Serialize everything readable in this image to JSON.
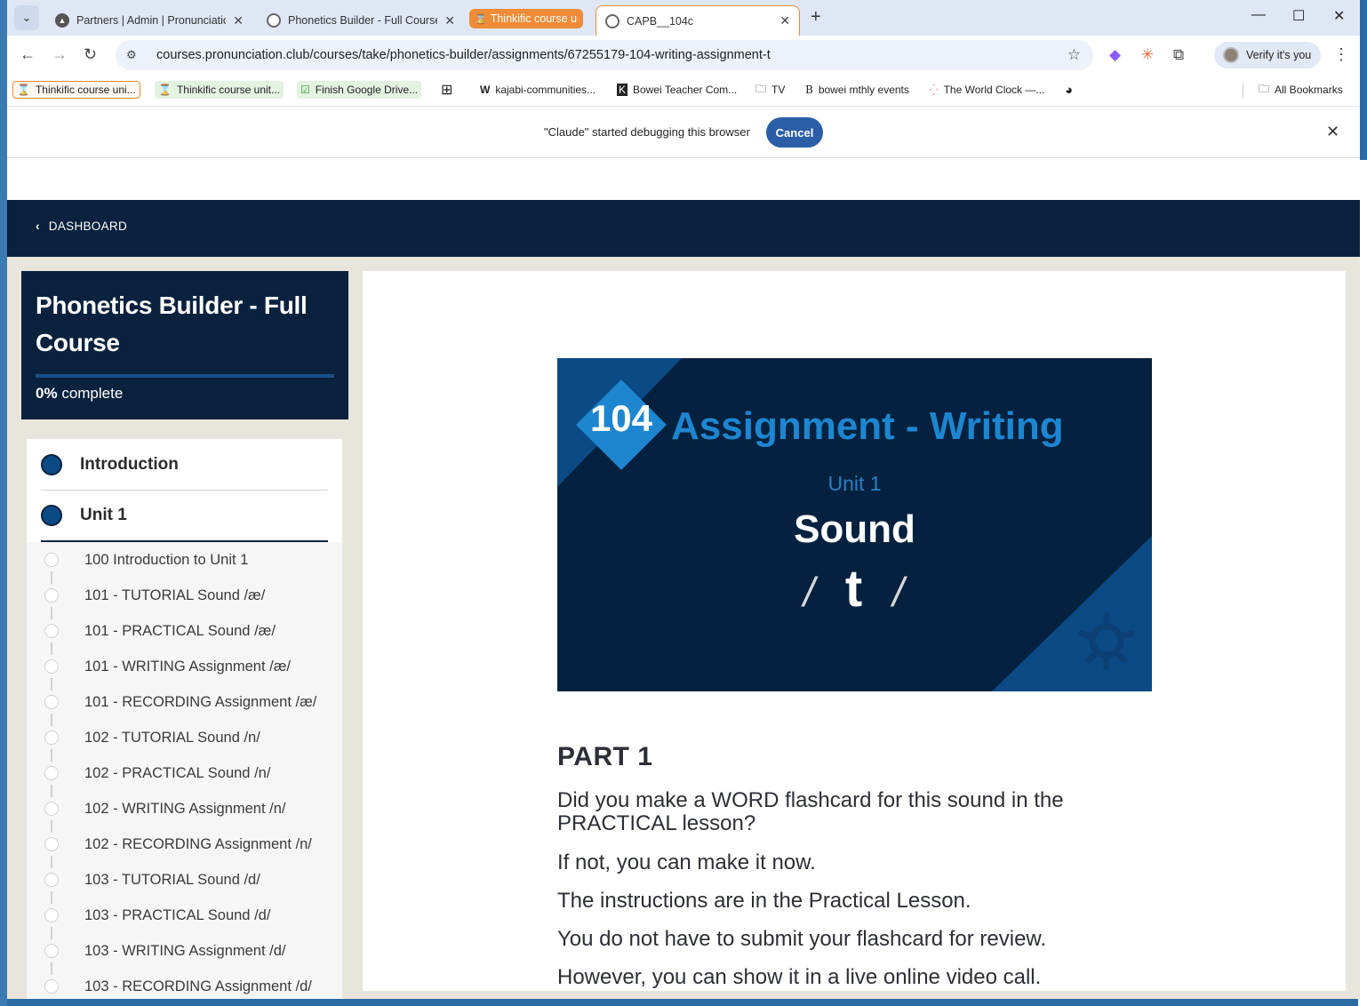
{
  "browser": {
    "tabs": [
      {
        "title": "Partners | Admin | Pronunciation"
      },
      {
        "title": "Phonetics Builder - Full Course"
      },
      {
        "title": "Thinkific course un"
      },
      {
        "title": "CAPB__104c"
      }
    ],
    "url": "courses.pronunciation.club/courses/take/phonetics-builder/assignments/67255179-104-writing-assignment-t",
    "profile_label": "Verify it's you",
    "bookmarks": [
      {
        "label": "Thinkific course uni..."
      },
      {
        "label": "Thinkific course unit..."
      },
      {
        "label": "Finish Google Drive..."
      },
      {
        "label": "kajabi-communities..."
      },
      {
        "label": "Bowei Teacher Com..."
      },
      {
        "label": "TV"
      },
      {
        "label": "bowei mthly events"
      },
      {
        "label": "The World Clock —..."
      }
    ],
    "all_bookmarks_label": "All Bookmarks",
    "debug_message": "\"Claude\" started debugging this browser",
    "debug_cancel": "Cancel"
  },
  "nav": {
    "back_label": "DASHBOARD"
  },
  "course": {
    "title": "Phonetics Builder - Full Course",
    "progress_percent": "0%",
    "progress_suffix": "complete",
    "progress_fraction": 0
  },
  "chapters": [
    {
      "label": "Introduction"
    },
    {
      "label": "Unit 1"
    }
  ],
  "lessons": [
    "100 Introduction to Unit 1",
    "101 - TUTORIAL Sound /æ/",
    "101 - PRACTICAL Sound /æ/",
    "101 - WRITING Assignment /æ/",
    "101 - RECORDING Assignment /æ/",
    "102 - TUTORIAL Sound /n/",
    "102 - PRACTICAL Sound /n/",
    "102 - WRITING Assignment /n/",
    "102 - RECORDING Assignment /n/",
    "103 - TUTORIAL Sound /d/",
    "103 - PRACTICAL Sound /d/",
    "103 - WRITING Assignment /d/",
    "103 - RECORDING Assignment /d/"
  ],
  "hero": {
    "number": "104",
    "title": "Assignment - Writing",
    "unit": "Unit 1",
    "sound_label": "Sound",
    "phoneme": "t",
    "slash": "/"
  },
  "content": {
    "part_heading": "PART 1",
    "paragraphs": [
      "Did you make a WORD flashcard for this sound in the PRACTICAL lesson?",
      "If not, you can make it now.",
      "The instructions are in the Practical Lesson.",
      "You do not have to submit your flashcard for review.",
      "However, you can show it in a live online video call."
    ]
  },
  "colors": {
    "navy": "#0a223d",
    "accent_blue": "#1e86d1",
    "tab_group_orange": "#f08b37",
    "cancel_blue": "#2b5ea7"
  }
}
